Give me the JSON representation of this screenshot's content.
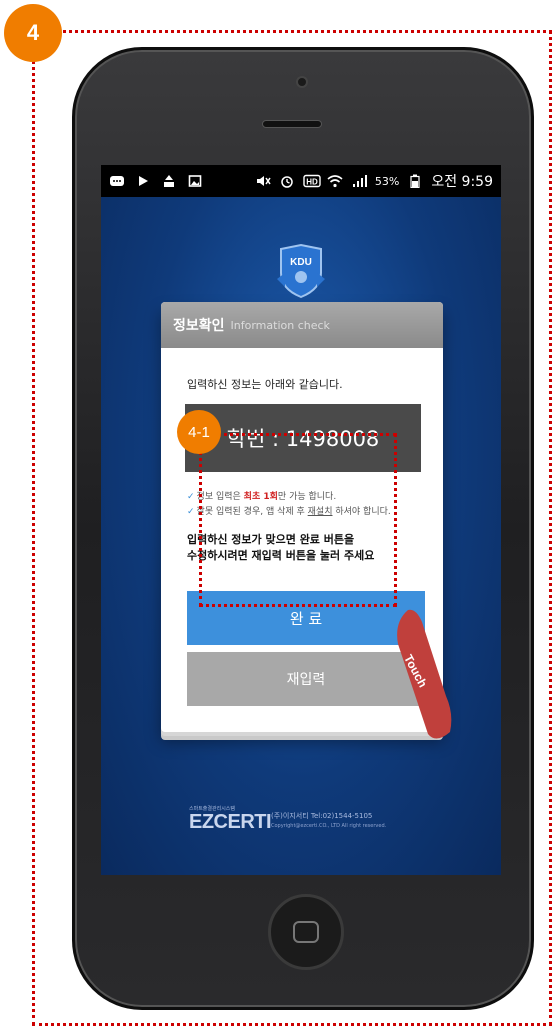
{
  "annotations": {
    "step_badge": "4",
    "sub_badge": "4-1",
    "touch_label": "Touch",
    "outline_color": "#cc0000",
    "badge_color": "#f07d00"
  },
  "status_bar": {
    "left_icons": [
      "message-icon",
      "play-icon",
      "upload-icon",
      "image-icon"
    ],
    "right_icons": [
      "mute-icon",
      "alarm-icon",
      "hd-icon",
      "wifi-icon",
      "signal-icon"
    ],
    "battery": "53%",
    "time": "오전 9:59"
  },
  "app": {
    "logo_text": "KDU"
  },
  "dialog": {
    "title": "정보확인",
    "subtitle": "Information check",
    "lead": "입력하신 정보는 아래와 같습니다.",
    "student_id": "학번 : 1498008",
    "note1": {
      "before": "정보 입력은 ",
      "highlight": "최초 1회",
      "after": "만 가능 합니다."
    },
    "note2": {
      "before": "잘못 입력된 경우, 앱 삭제 후 ",
      "underline": "재설치",
      "after": " 하셔야 합니다."
    },
    "instruction_line1": "입력하신 정보가 맞으면 완료 버튼을",
    "instruction_line2": "수정하시려면 재입력 버튼을 눌러 주세요",
    "confirm_label": "완 료",
    "reenter_label": "재입력",
    "confirm_color": "#3d90dc",
    "reenter_color": "#a8a8a8"
  },
  "footer": {
    "small_caption": "스마트출결관리시스템",
    "brand": "EZCERTI",
    "company_line": "(주)이지서티 Tel:02)1544-5105",
    "copyright": "Copyright@ezcerti.CO., LTD All right reserved."
  }
}
